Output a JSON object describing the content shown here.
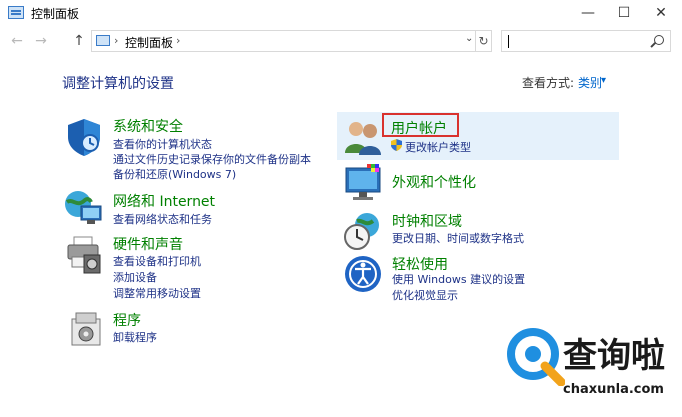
{
  "window": {
    "title": "控制面板",
    "minimize_glyph": "—",
    "maximize_glyph": "☐",
    "close_glyph": "✕"
  },
  "address_bar": {
    "back_glyph": "←",
    "forward_glyph": "→",
    "up_glyph": "↑",
    "path": "控制面板",
    "separator": "›",
    "dropdown_glyph": "⌄",
    "refresh_glyph": "↻",
    "search_value": "",
    "search_placeholder": ""
  },
  "header": {
    "heading": "调整计算机的设置",
    "view_by_label": "查看方式:",
    "view_by_value": "类别",
    "view_by_caret": "▾"
  },
  "categories": {
    "system_security": {
      "title": "系统和安全",
      "links": [
        "查看你的计算机状态",
        "通过文件历史记录保存你的文件备份副本",
        "备份和还原(Windows 7)"
      ]
    },
    "network": {
      "title": "网络和 Internet",
      "links": [
        "查看网络状态和任务"
      ]
    },
    "hardware_sound": {
      "title": "硬件和声音",
      "links": [
        "查看设备和打印机",
        "添加设备",
        "调整常用移动设置"
      ]
    },
    "programs": {
      "title": "程序",
      "links": [
        "卸载程序"
      ]
    },
    "user_accounts": {
      "title": "用户帐户",
      "links": [
        "更改帐户类型"
      ]
    },
    "appearance": {
      "title": "外观和个性化",
      "links": []
    },
    "clock_region": {
      "title": "时钟和区域",
      "links": [
        "更改日期、时间或数字格式"
      ]
    },
    "ease_of_access": {
      "title": "轻松使用",
      "links": [
        "使用 Windows 建议的设置",
        "优化视觉显示"
      ]
    }
  },
  "watermark": {
    "brand": "查询啦",
    "domain": "chaxunla.com"
  },
  "colors": {
    "link": "#1e3287",
    "category_title": "#008000",
    "highlight": "#e5f1fb",
    "red_box": "#d9322e"
  }
}
